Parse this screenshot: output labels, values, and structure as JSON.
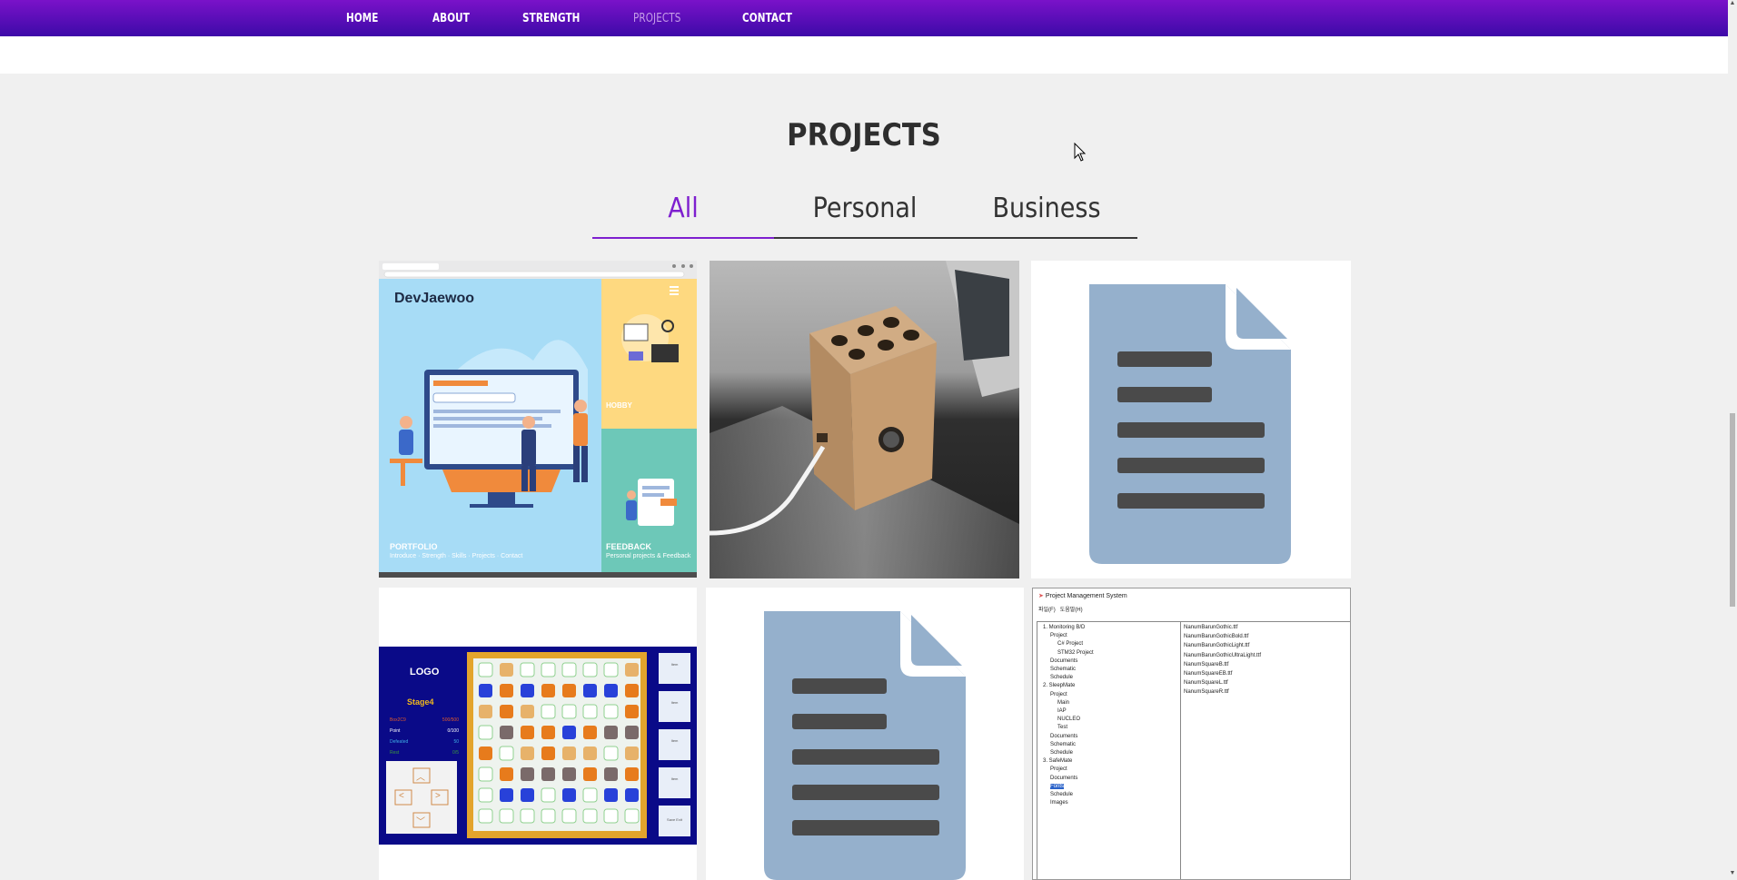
{
  "nav": {
    "items": [
      "HOME",
      "ABOUT",
      "STRENGTH",
      "PROJECTS",
      "CONTACT"
    ],
    "active": "PROJECTS"
  },
  "section_title": "PROJECTS",
  "tabs": [
    "All",
    "Personal",
    "Business"
  ],
  "active_tab": "All",
  "colors": {
    "accent": "#7e1fcf",
    "nav_top": "#7a12c9",
    "nav_bottom": "#3d0aa8",
    "doc_icon": "#95b0cc",
    "doc_lines": "#4a4a4a"
  },
  "portfolio_card": {
    "brand": "DevJaewoo",
    "panel1_title": "PORTFOLIO",
    "panel1_sub": "Introduce · Strength · Skills · Projects · Contact",
    "panel2_title": "HOBBY",
    "panel3_title": "FEEDBACK",
    "panel3_sub": "Personal projects & Feedback"
  },
  "game_card": {
    "logo": "LOGO",
    "stage": "Stage4",
    "stats": [
      {
        "label": "Box2C9",
        "value": "500/500"
      },
      {
        "label": "Point",
        "value": "0/100"
      },
      {
        "label": "Defeated",
        "value": "50"
      },
      {
        "label": "Rest",
        "value": "0/5"
      }
    ],
    "side_buttons": [
      "Item",
      "Item",
      "Item",
      "Item",
      "Save Exit"
    ]
  },
  "pms_card": {
    "window_title": "Project Management System",
    "menu": [
      "파일(F)",
      "도움말(H)"
    ],
    "tree": [
      "1. Monitoring B/D",
      "Project",
      "C# Project",
      "STM32 Project",
      "Documents",
      "Schematic",
      "Schedule",
      "2. SleepMate",
      "Project",
      "Main",
      "IAP",
      "NUCLEO",
      "Test",
      "Documents",
      "Schematic",
      "Schedule",
      "3. SafeMate",
      "Project",
      "Documents",
      "Fonts",
      "Schedule",
      "Images"
    ],
    "files": [
      "NanumBarunGothic.ttf",
      "NanumBarunGothicBold.ttf",
      "NanumBarunGothicLight.ttf",
      "NanumBarunGothicUltraLight.ttf",
      "NanumSquareB.ttf",
      "NanumSquareEB.ttf",
      "NanumSquareL.ttf",
      "NanumSquareR.ttf"
    ]
  }
}
